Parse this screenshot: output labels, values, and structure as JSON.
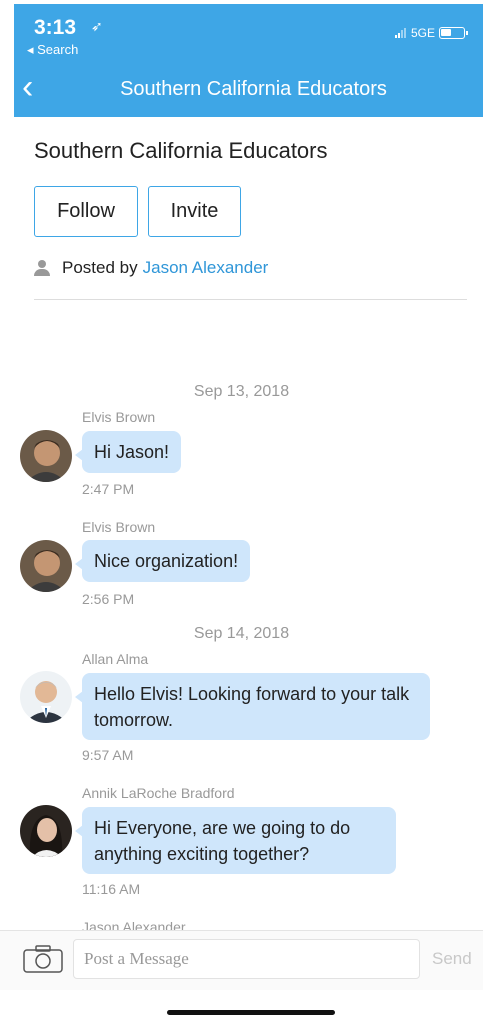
{
  "status_bar": {
    "time": "3:13",
    "back_app": "Search",
    "network": "5GE"
  },
  "nav": {
    "title": "Southern California Educators"
  },
  "group": {
    "title": "Southern California Educators",
    "follow_label": "Follow",
    "invite_label": "Invite",
    "posted_by_label": "Posted by",
    "posted_by_name": "Jason Alexander"
  },
  "chat": {
    "dates": [
      "Sep 13, 2018",
      "Sep 14, 2018"
    ],
    "messages": [
      {
        "sender": "Elvis Brown",
        "text": "Hi Jason!",
        "time": "2:47 PM"
      },
      {
        "sender": "Elvis Brown",
        "text": "Nice organization!",
        "time": "2:56 PM"
      },
      {
        "sender": "Allan Alma",
        "text": "Hello Elvis! Looking forward to your talk tomorrow.",
        "time": "9:57 AM"
      },
      {
        "sender": "Annik LaRoche Bradford",
        "text": "Hi Everyone, are we going to do anything exciting together?",
        "time": "11:16 AM"
      },
      {
        "sender": "Jason Alexander"
      }
    ]
  },
  "composer": {
    "placeholder": "Post a Message",
    "send_label": "Send"
  },
  "colors": {
    "header": "#3ea6e6",
    "bubble": "#cfe6fb",
    "link": "#2f96d8"
  }
}
